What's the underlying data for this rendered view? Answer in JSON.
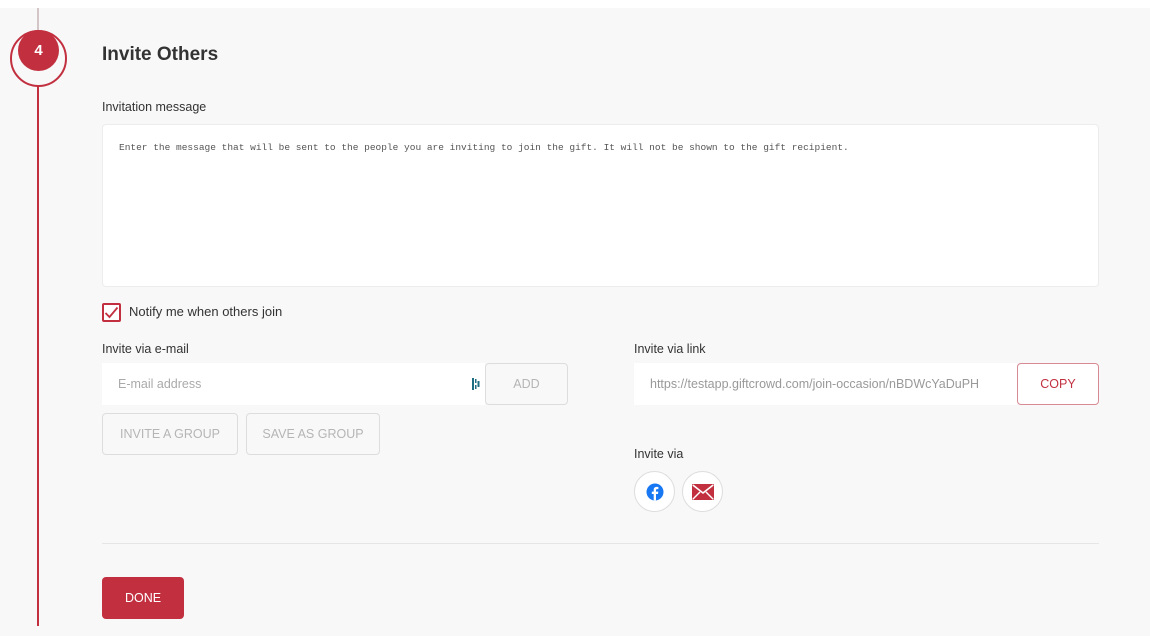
{
  "step": {
    "number": "4",
    "title": "Invite Others"
  },
  "message": {
    "label": "Invitation message",
    "placeholder": "Enter the message that will be sent to the people you are inviting to join the gift. It will not be shown to the gift recipient.",
    "value": ""
  },
  "notify": {
    "label": "Notify me when others join",
    "checked": true
  },
  "email": {
    "label": "Invite via e-mail",
    "placeholder": "E-mail address",
    "value": "",
    "add_label": "ADD",
    "invite_group_label": "INVITE A GROUP",
    "save_group_label": "SAVE AS GROUP"
  },
  "link": {
    "label": "Invite via link",
    "value": "https://testapp.giftcrowd.com/join-occasion/nBDWcYaDuPH",
    "copy_label": "COPY"
  },
  "social": {
    "label": "Invite via",
    "items": [
      {
        "name": "facebook",
        "icon": "facebook-icon",
        "color": "#1877f2"
      },
      {
        "name": "email",
        "icon": "envelope-icon",
        "color": "#c23040"
      }
    ]
  },
  "footer": {
    "done_label": "DONE"
  },
  "colors": {
    "accent": "#c23040",
    "background": "#f8f8f8"
  }
}
